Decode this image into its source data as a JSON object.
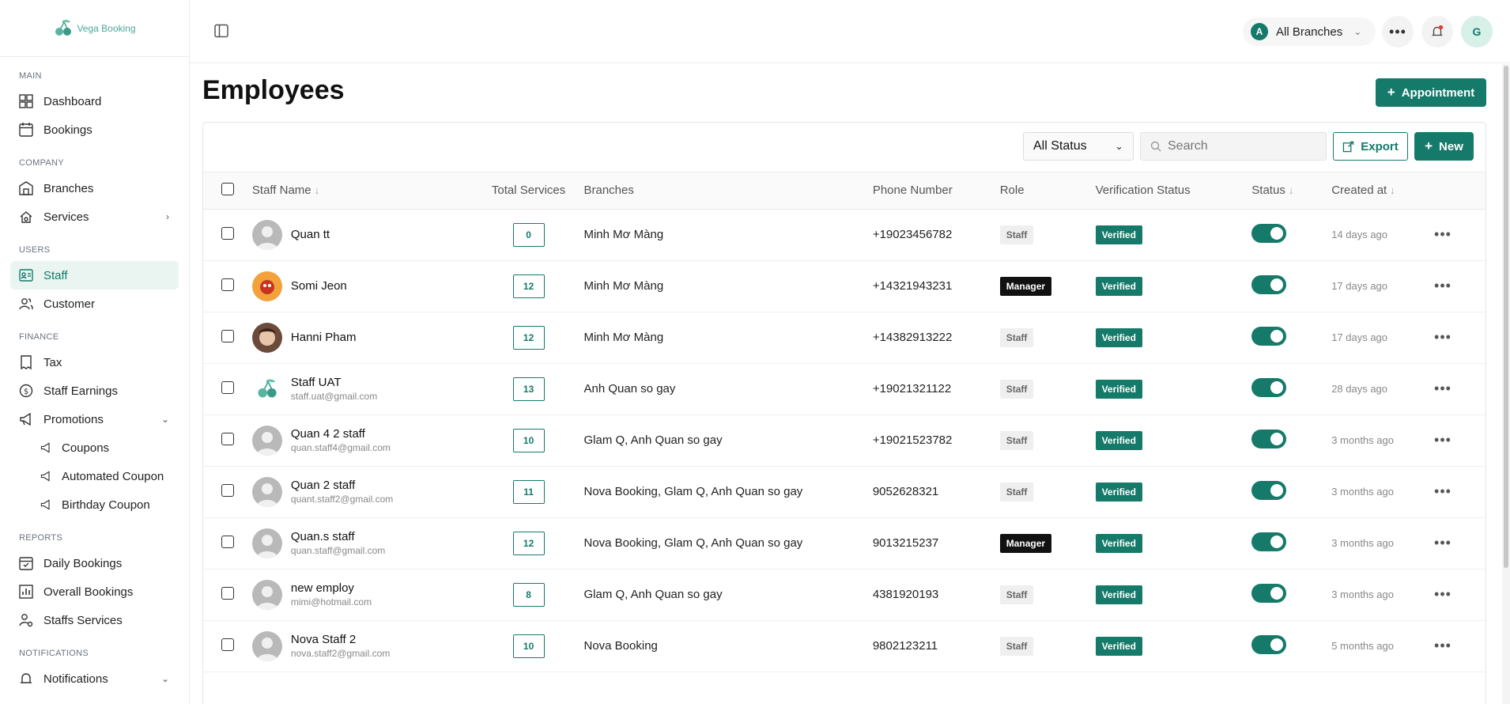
{
  "app": {
    "logo_text": "Vega Booking"
  },
  "sidebar": {
    "sections": {
      "main": "MAIN",
      "company": "COMPANY",
      "users": "USERS",
      "finance": "FINANCE",
      "reports": "REPORTS",
      "notifications": "NOTIFICATIONS"
    },
    "items": {
      "dashboard": "Dashboard",
      "bookings": "Bookings",
      "branches": "Branches",
      "services": "Services",
      "staff": "Staff",
      "customer": "Customer",
      "tax": "Tax",
      "staff_earnings": "Staff Earnings",
      "promotions": "Promotions",
      "coupons": "Coupons",
      "automated_coupon": "Automated Coupon",
      "birthday_coupon": "Birthday Coupon",
      "daily_bookings": "Daily Bookings",
      "overall_bookings": "Overall Bookings",
      "staffs_services": "Staffs Services",
      "notifications": "Notifications"
    },
    "active_item": "staff"
  },
  "topbar": {
    "branch_avatar_letter": "A",
    "branch_label": "All Branches",
    "user_avatar_letter": "G"
  },
  "page": {
    "title": "Employees",
    "appointment_button": "Appointment"
  },
  "toolbar": {
    "status_filter": "All Status",
    "search_placeholder": "Search",
    "export_label": "Export",
    "new_label": "New"
  },
  "table": {
    "columns": {
      "staff_name": "Staff Name",
      "total_services": "Total Services",
      "branches": "Branches",
      "phone": "Phone Number",
      "role": "Role",
      "verification": "Verification Status",
      "status": "Status",
      "created": "Created at"
    },
    "rows": [
      {
        "name": "Quan tt",
        "email": "",
        "services": "0",
        "branches": "Minh Mơ Màng",
        "phone": "+19023456782",
        "role": "Staff",
        "verification": "Verified",
        "status_on": true,
        "created": "14 days ago",
        "avatar": "gray"
      },
      {
        "name": "Somi Jeon",
        "email": "",
        "services": "12",
        "branches": "Minh Mơ Màng",
        "phone": "+14321943231",
        "role": "Manager",
        "verification": "Verified",
        "status_on": true,
        "created": "17 days ago",
        "avatar": "orange"
      },
      {
        "name": "Hanni Pham",
        "email": "",
        "services": "12",
        "branches": "Minh Mơ Màng",
        "phone": "+14382913222",
        "role": "Staff",
        "verification": "Verified",
        "status_on": true,
        "created": "17 days ago",
        "avatar": "photo"
      },
      {
        "name": "Staff UAT",
        "email": "staff.uat@gmail.com",
        "services": "13",
        "branches": "Anh Quan so gay",
        "phone": "+19021321122",
        "role": "Staff",
        "verification": "Verified",
        "status_on": true,
        "created": "28 days ago",
        "avatar": "logo"
      },
      {
        "name": "Quan 4 2 staff",
        "email": "quan.staff4@gmail.com",
        "services": "10",
        "branches": "Glam Q, Anh Quan so gay",
        "phone": "+19021523782",
        "role": "Staff",
        "verification": "Verified",
        "status_on": true,
        "created": "3 months ago",
        "avatar": "gray"
      },
      {
        "name": "Quan 2 staff",
        "email": "quant.staff2@gmail.com",
        "services": "11",
        "branches": "Nova Booking, Glam Q, Anh Quan so gay",
        "phone": "9052628321",
        "role": "Staff",
        "verification": "Verified",
        "status_on": true,
        "created": "3 months ago",
        "avatar": "gray"
      },
      {
        "name": "Quan.s staff",
        "email": "quan.staff@gmail.com",
        "services": "12",
        "branches": "Nova Booking, Glam Q, Anh Quan so gay",
        "phone": "9013215237",
        "role": "Manager",
        "verification": "Verified",
        "status_on": true,
        "created": "3 months ago",
        "avatar": "gray"
      },
      {
        "name": "new employ",
        "email": "mimi@hotmail.com",
        "services": "8",
        "branches": "Glam Q, Anh Quan so gay",
        "phone": "4381920193",
        "role": "Staff",
        "verification": "Verified",
        "status_on": true,
        "created": "3 months ago",
        "avatar": "gray"
      },
      {
        "name": "Nova Staff 2",
        "email": "nova.staff2@gmail.com",
        "services": "10",
        "branches": "Nova Booking",
        "phone": "9802123211",
        "role": "Staff",
        "verification": "Verified",
        "status_on": true,
        "created": "5 months ago",
        "avatar": "gray"
      }
    ]
  },
  "colors": {
    "accent": "#157a69",
    "active_bg": "#eaf5f2",
    "manager_bg": "#111111"
  }
}
